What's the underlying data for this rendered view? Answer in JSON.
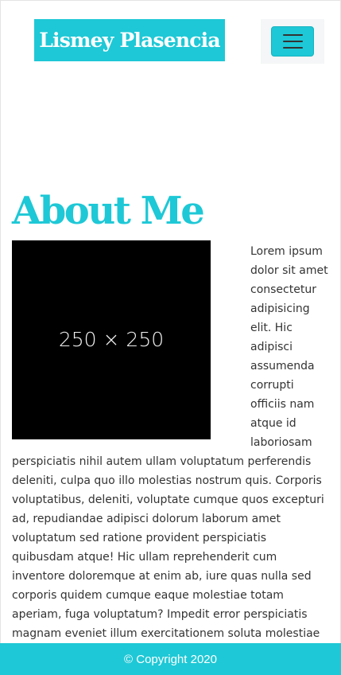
{
  "navbar": {
    "brand": "Lismey Plasencia",
    "toggler_icon": "hamburger-menu-icon"
  },
  "about": {
    "heading": "About Me",
    "image_placeholder": "250 × 250",
    "paragraph": "Lorem ipsum dolor sit amet consectetur adipisicing elit. Hic adipisci assumenda corrupti officiis nam atque id laboriosam perspiciatis nihil autem ullam voluptatum perferendis deleniti, culpa quo illo molestias nostrum quis. Corporis voluptatibus, deleniti, voluptate cumque quos excepturi ad, repudiandae adipisci dolorum laborum amet voluptatum sed ratione provident perspiciatis quibusdam atque! Hic ullam reprehenderit cum inventore doloremque at enim ab, iure quas nulla sed corporis quidem cumque eaque molestiae totam aperiam, fuga voluptatum? Impedit error perspiciatis magnam eveniet illum exercitationem soluta molestiae"
  },
  "footer": {
    "copyright": "© Copyright 2020"
  },
  "colors": {
    "accent": "#1ec8d6",
    "placeholder_bg": "#000000",
    "text": "#333333"
  }
}
